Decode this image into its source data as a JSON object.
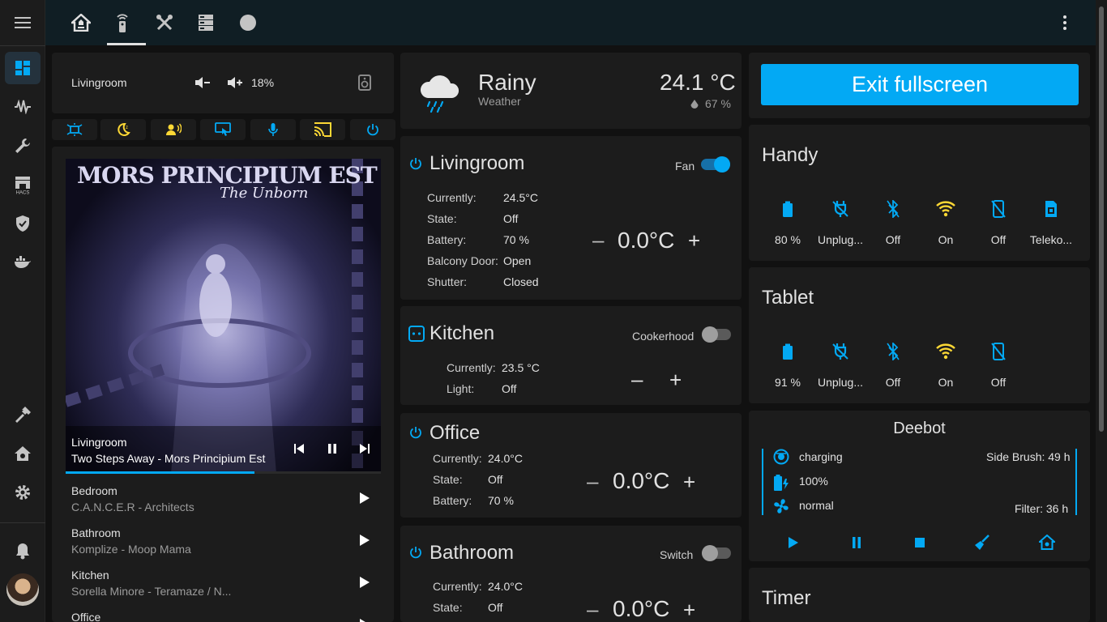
{
  "colors": {
    "accent": "#03a9f4",
    "yellow": "#fdd835",
    "icon": "#c4c4c4"
  },
  "sidebar": {
    "items": [
      {
        "icon": "menu-icon"
      },
      {
        "icon": "dashboard-icon",
        "active": true
      },
      {
        "icon": "waveform-icon"
      },
      {
        "icon": "wrench-icon"
      },
      {
        "icon": "hacs-store-icon",
        "sub_label": "HACS"
      },
      {
        "icon": "shield-check-icon"
      },
      {
        "icon": "docker-icon"
      },
      {
        "icon": "hammer-icon"
      },
      {
        "icon": "home-gear-icon"
      },
      {
        "icon": "gear-icon"
      },
      {
        "icon": "bell-icon"
      },
      {
        "icon": "avatar"
      }
    ]
  },
  "topbar": {
    "tabs": [
      "home-automation-icon",
      "remote-icon",
      "tools-icon",
      "server-icon",
      "theme-icon"
    ],
    "menu_icon": "dots-vertical-icon"
  },
  "media_header": {
    "name": "Livingroom",
    "volume": "18%"
  },
  "chips": [
    "ambilight-icon",
    "sleep-icon",
    "voice-icon",
    "screen-touch-icon",
    "microphone-icon",
    "cast-icon",
    "power-icon"
  ],
  "now_playing": {
    "album_title": "MORS PRINCIPIUM EST",
    "album_subtitle": "The Unborn",
    "room": "Livingroom",
    "track": "Two Steps Away - Mors Principium Est",
    "progress": 0.6
  },
  "media_list": [
    {
      "room": "Bedroom",
      "track": "C.A.N.C.E.R - Architects"
    },
    {
      "room": "Bathroom",
      "track": "Komplize - Moop Mama"
    },
    {
      "room": "Kitchen",
      "track": "Sorella Minore - Teramaze / N..."
    },
    {
      "room": "Office",
      "track": ""
    }
  ],
  "weather": {
    "condition": "Rainy",
    "label": "Weather",
    "temperature": "24.1 °C",
    "humidity": "67 %"
  },
  "rooms": {
    "livingroom": {
      "title": "Livingroom",
      "toggle_label": "Fan",
      "toggle_on": true,
      "target": "0.0°C",
      "rows": [
        {
          "label": "Currently:",
          "value": "24.5°C"
        },
        {
          "label": "State:",
          "value": "Off"
        },
        {
          "label": "Battery:",
          "value": "70 %"
        },
        {
          "label": "Balcony Door:",
          "value": "Open"
        },
        {
          "label": "Shutter:",
          "value": "Closed"
        }
      ]
    },
    "kitchen": {
      "title": "Kitchen",
      "toggle_label": "Cookerhood",
      "toggle_on": false,
      "rows": [
        {
          "label": "Currently:",
          "value": "23.5 °C"
        },
        {
          "label": "Light:",
          "value": "Off"
        }
      ]
    },
    "office": {
      "title": "Office",
      "target": "0.0°C",
      "rows": [
        {
          "label": "Currently:",
          "value": "24.0°C"
        },
        {
          "label": "State:",
          "value": "Off"
        },
        {
          "label": "Battery:",
          "value": "70 %"
        }
      ]
    },
    "bathroom": {
      "title": "Bathroom",
      "toggle_label": "Switch",
      "toggle_on": false,
      "target": "0.0°C",
      "rows": [
        {
          "label": "Currently:",
          "value": "24.0°C"
        },
        {
          "label": "State:",
          "value": "Off"
        }
      ]
    }
  },
  "exit_button": "Exit fullscreen",
  "handy": {
    "title": "Handy",
    "stats": [
      {
        "icon": "battery-icon",
        "value": "80 %"
      },
      {
        "icon": "power-plug-off-icon",
        "value": "Unplug..."
      },
      {
        "icon": "bluetooth-off-icon",
        "value": "Off"
      },
      {
        "icon": "wifi-icon",
        "value": "On"
      },
      {
        "icon": "cellphone-off-icon",
        "value": "Off"
      },
      {
        "icon": "sim-icon",
        "value": "Teleko..."
      }
    ]
  },
  "tablet": {
    "title": "Tablet",
    "stats": [
      {
        "icon": "battery-icon",
        "value": "91 %"
      },
      {
        "icon": "power-plug-off-icon",
        "value": "Unplug..."
      },
      {
        "icon": "bluetooth-off-icon",
        "value": "Off"
      },
      {
        "icon": "wifi-icon",
        "value": "On"
      },
      {
        "icon": "cellphone-off-icon",
        "value": "Off"
      }
    ]
  },
  "deebot": {
    "title": "Deebot",
    "status": "charging",
    "battery": "100%",
    "fan": "normal",
    "side_brush": "Side Brush: 49 h",
    "filter": "Filter: 36 h"
  },
  "timer": {
    "title": "Timer"
  }
}
